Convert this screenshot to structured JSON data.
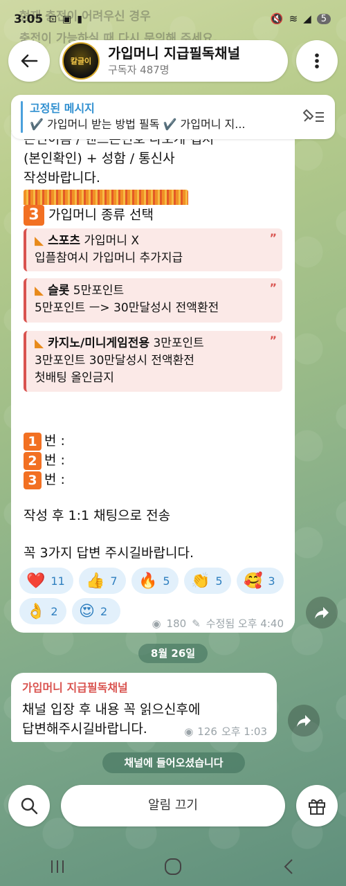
{
  "status_bar": {
    "time": "3:05",
    "left_icons": [
      "notification-icon",
      "sim-icon",
      "lock-icon"
    ],
    "right_icons": [
      "mute-icon",
      "wifi-icon",
      "signal-icon"
    ],
    "battery": "5"
  },
  "background_text": {
    "line1": "현재 충전이 어려우신 경우",
    "line2": "충전이 가능하실 때 다시 문의해 주세요."
  },
  "header": {
    "title": "가입머니 지급필독채널",
    "subtitle": "구독자 487명",
    "avatar_text": "칼글이"
  },
  "pinned": {
    "title": "고정된 메시지",
    "body": "✔️ 가입머니 받는 방법 필독 ✔️ 가입머니 지..."
  },
  "message": {
    "partial_top": "은인이름 / 핸드폰번호 나오게 캡처",
    "line_verify": "(본인확인) + 성함 / 통신사",
    "line_request": "작성바랍니다.",
    "section3_num": "3",
    "section3_title": "가입머니 종류 선택",
    "quotes": [
      {
        "title": "스포츠",
        "title_rest": " 가입머니 X",
        "line2": "입플참여시 가입머니 추가지급",
        "line3": ""
      },
      {
        "title": "슬롯",
        "title_rest": " 5만포인트",
        "line2": "5만포인트 ㅡ> 30만달성시 전액환전",
        "line3": ""
      },
      {
        "title": "카지노/미니게임전용",
        "title_rest": " 3만포인트",
        "line2": "3만포인트 30만달성시 전액환전",
        "line3": "첫배팅 올인금지"
      }
    ],
    "answer_lines": [
      {
        "num": "1",
        "label": "번 :"
      },
      {
        "num": "2",
        "label": "번 :"
      },
      {
        "num": "3",
        "label": "번 :"
      }
    ],
    "send_note": "작성 후 1:1 채팅으로 전송",
    "final_note": "꼭 3가지 답변 주시길바랍니다.",
    "reactions": [
      {
        "emoji": "❤️",
        "count": "11"
      },
      {
        "emoji": "👍",
        "count": "7"
      },
      {
        "emoji": "🔥",
        "count": "5"
      },
      {
        "emoji": "👏",
        "count": "5"
      },
      {
        "emoji": "🥰",
        "count": "3"
      },
      {
        "emoji": "👌",
        "count": "2"
      },
      {
        "emoji": "😍",
        "count": "2"
      }
    ],
    "views": "180",
    "edited": "수정됨 오후 4:40"
  },
  "date_separator": "8월 26일",
  "message2": {
    "sender": "가입머니 지급필독채널",
    "line1": "채널 입장 후 내용 꼭 읽으신후에",
    "line2": "답변해주시길바랍니다.",
    "views": "126",
    "time": "오후 1:03"
  },
  "joined_notice": "채널에 들어오셨습니다",
  "bottom": {
    "mute_label": "알림 끄기"
  },
  "colors": {
    "accent_blue": "#2f8fd0",
    "quote_red": "#d9534f",
    "badge_orange": "#f27022"
  }
}
